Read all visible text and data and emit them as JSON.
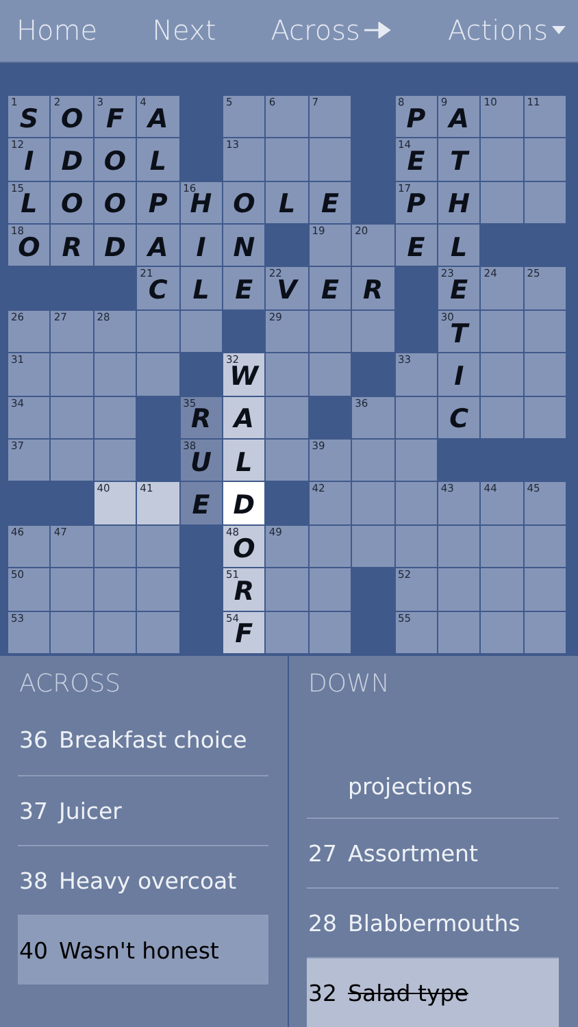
{
  "toolbar": {
    "items": [
      {
        "label": "Home",
        "kind": "plain"
      },
      {
        "label": "Next",
        "kind": "plain"
      },
      {
        "label": "Across",
        "kind": "arrow"
      },
      {
        "label": "Actions",
        "kind": "menu"
      }
    ]
  },
  "grid": {
    "rows": [
      [
        {
          "kind": "cell",
          "number": "1",
          "letter": "S"
        },
        {
          "kind": "cell",
          "number": "2",
          "letter": "O"
        },
        {
          "kind": "cell",
          "number": "3",
          "letter": "F"
        },
        {
          "kind": "cell",
          "number": "4",
          "letter": "A"
        },
        {
          "kind": "block"
        },
        {
          "kind": "cell",
          "number": "5"
        },
        {
          "kind": "cell",
          "number": "6"
        },
        {
          "kind": "cell",
          "number": "7"
        },
        {
          "kind": "block"
        },
        {
          "kind": "cell",
          "number": "8",
          "letter": "P"
        },
        {
          "kind": "cell",
          "number": "9",
          "letter": "A"
        },
        {
          "kind": "cell",
          "number": "10"
        },
        {
          "kind": "cell",
          "number": "11"
        }
      ],
      [
        {
          "kind": "cell",
          "number": "12",
          "letter": "I"
        },
        {
          "kind": "cell",
          "letter": "D"
        },
        {
          "kind": "cell",
          "letter": "O"
        },
        {
          "kind": "cell",
          "letter": "L"
        },
        {
          "kind": "block"
        },
        {
          "kind": "cell",
          "number": "13"
        },
        {
          "kind": "cell"
        },
        {
          "kind": "cell"
        },
        {
          "kind": "block"
        },
        {
          "kind": "cell",
          "number": "14",
          "letter": "E"
        },
        {
          "kind": "cell",
          "letter": "T"
        },
        {
          "kind": "cell"
        },
        {
          "kind": "cell"
        }
      ],
      [
        {
          "kind": "cell",
          "number": "15",
          "letter": "L"
        },
        {
          "kind": "cell",
          "letter": "O"
        },
        {
          "kind": "cell",
          "letter": "O"
        },
        {
          "kind": "cell",
          "letter": "P"
        },
        {
          "kind": "cell",
          "number": "16",
          "letter": "H"
        },
        {
          "kind": "cell",
          "letter": "O"
        },
        {
          "kind": "cell",
          "letter": "L"
        },
        {
          "kind": "cell",
          "letter": "E"
        },
        {
          "kind": "block"
        },
        {
          "kind": "cell",
          "number": "17",
          "letter": "P"
        },
        {
          "kind": "cell",
          "letter": "H"
        },
        {
          "kind": "cell"
        },
        {
          "kind": "cell"
        }
      ],
      [
        {
          "kind": "cell",
          "number": "18",
          "letter": "O"
        },
        {
          "kind": "cell",
          "letter": "R"
        },
        {
          "kind": "cell",
          "letter": "D"
        },
        {
          "kind": "cell",
          "letter": "A"
        },
        {
          "kind": "cell",
          "letter": "I"
        },
        {
          "kind": "cell",
          "letter": "N"
        },
        {
          "kind": "block"
        },
        {
          "kind": "cell",
          "number": "19"
        },
        {
          "kind": "cell",
          "number": "20"
        },
        {
          "kind": "cell",
          "letter": "E"
        },
        {
          "kind": "cell",
          "letter": "L"
        },
        {
          "kind": "block"
        },
        {
          "kind": "block"
        }
      ],
      [
        {
          "kind": "block"
        },
        {
          "kind": "block"
        },
        {
          "kind": "block"
        },
        {
          "kind": "cell",
          "number": "21",
          "letter": "C"
        },
        {
          "kind": "cell",
          "letter": "L"
        },
        {
          "kind": "cell",
          "letter": "E"
        },
        {
          "kind": "cell",
          "number": "22",
          "letter": "V"
        },
        {
          "kind": "cell",
          "letter": "E"
        },
        {
          "kind": "cell",
          "letter": "R"
        },
        {
          "kind": "block"
        },
        {
          "kind": "cell",
          "number": "23",
          "letter": "E"
        },
        {
          "kind": "cell",
          "number": "24"
        },
        {
          "kind": "cell",
          "number": "25"
        }
      ],
      [
        {
          "kind": "cell",
          "number": "26"
        },
        {
          "kind": "cell",
          "number": "27"
        },
        {
          "kind": "cell",
          "number": "28"
        },
        {
          "kind": "cell"
        },
        {
          "kind": "cell"
        },
        {
          "kind": "block"
        },
        {
          "kind": "cell",
          "number": "29"
        },
        {
          "kind": "cell"
        },
        {
          "kind": "cell"
        },
        {
          "kind": "block"
        },
        {
          "kind": "cell",
          "number": "30",
          "letter": "T"
        },
        {
          "kind": "cell"
        },
        {
          "kind": "cell"
        }
      ],
      [
        {
          "kind": "cell",
          "number": "31"
        },
        {
          "kind": "cell"
        },
        {
          "kind": "cell"
        },
        {
          "kind": "cell"
        },
        {
          "kind": "block"
        },
        {
          "kind": "word-cell",
          "number": "32",
          "letter": "W"
        },
        {
          "kind": "cell"
        },
        {
          "kind": "cell"
        },
        {
          "kind": "block"
        },
        {
          "kind": "cell",
          "number": "33"
        },
        {
          "kind": "cell",
          "letter": "I"
        },
        {
          "kind": "cell"
        },
        {
          "kind": "cell"
        }
      ],
      [
        {
          "kind": "cell",
          "number": "34"
        },
        {
          "kind": "cell"
        },
        {
          "kind": "cell"
        },
        {
          "kind": "block"
        },
        {
          "kind": "shaded-cell",
          "number": "35",
          "letter": "R"
        },
        {
          "kind": "word-cell",
          "letter": "A"
        },
        {
          "kind": "cell"
        },
        {
          "kind": "block"
        },
        {
          "kind": "cell",
          "number": "36"
        },
        {
          "kind": "cell"
        },
        {
          "kind": "cell",
          "letter": "C"
        },
        {
          "kind": "cell"
        },
        {
          "kind": "cell"
        }
      ],
      [
        {
          "kind": "cell",
          "number": "37"
        },
        {
          "kind": "cell"
        },
        {
          "kind": "cell"
        },
        {
          "kind": "block"
        },
        {
          "kind": "shaded-cell",
          "number": "38",
          "letter": "U"
        },
        {
          "kind": "word-cell",
          "letter": "L"
        },
        {
          "kind": "cell"
        },
        {
          "kind": "cell",
          "number": "39"
        },
        {
          "kind": "cell"
        },
        {
          "kind": "cell"
        },
        {
          "kind": "block"
        },
        {
          "kind": "block"
        },
        {
          "kind": "block"
        }
      ],
      [
        {
          "kind": "block"
        },
        {
          "kind": "block"
        },
        {
          "kind": "word-cell",
          "number": "40"
        },
        {
          "kind": "word-cell",
          "number": "41"
        },
        {
          "kind": "shaded-cell",
          "letter": "E"
        },
        {
          "kind": "cursor-cell",
          "letter": "D"
        },
        {
          "kind": "block"
        },
        {
          "kind": "cell",
          "number": "42"
        },
        {
          "kind": "cell"
        },
        {
          "kind": "cell"
        },
        {
          "kind": "cell",
          "number": "43"
        },
        {
          "kind": "cell",
          "number": "44"
        },
        {
          "kind": "cell",
          "number": "45"
        }
      ],
      [
        {
          "kind": "cell",
          "number": "46"
        },
        {
          "kind": "cell",
          "number": "47"
        },
        {
          "kind": "cell"
        },
        {
          "kind": "cell"
        },
        {
          "kind": "block"
        },
        {
          "kind": "word-cell",
          "number": "48",
          "letter": "O"
        },
        {
          "kind": "cell",
          "number": "49"
        },
        {
          "kind": "cell"
        },
        {
          "kind": "cell"
        },
        {
          "kind": "cell"
        },
        {
          "kind": "cell"
        },
        {
          "kind": "cell"
        },
        {
          "kind": "cell"
        }
      ],
      [
        {
          "kind": "cell",
          "number": "50"
        },
        {
          "kind": "cell"
        },
        {
          "kind": "cell"
        },
        {
          "kind": "cell"
        },
        {
          "kind": "block"
        },
        {
          "kind": "word-cell",
          "number": "51",
          "letter": "R"
        },
        {
          "kind": "cell"
        },
        {
          "kind": "cell"
        },
        {
          "kind": "block"
        },
        {
          "kind": "cell",
          "number": "52"
        },
        {
          "kind": "cell"
        },
        {
          "kind": "cell"
        },
        {
          "kind": "cell"
        }
      ],
      [
        {
          "kind": "cell",
          "number": "53"
        },
        {
          "kind": "cell"
        },
        {
          "kind": "cell"
        },
        {
          "kind": "cell"
        },
        {
          "kind": "block"
        },
        {
          "kind": "word-cell",
          "number": "54",
          "letter": "F"
        },
        {
          "kind": "cell"
        },
        {
          "kind": "cell"
        },
        {
          "kind": "block"
        },
        {
          "kind": "cell",
          "number": "55"
        },
        {
          "kind": "cell"
        },
        {
          "kind": "cell"
        },
        {
          "kind": "cell"
        }
      ]
    ]
  },
  "clue_panels": [
    {
      "heading": "ACROSS",
      "clues": [
        {
          "number": "36",
          "text": "Breakfast choice",
          "selected": false,
          "done": false
        },
        {
          "number": "37",
          "text": "Juicer",
          "selected": false,
          "done": false
        },
        {
          "number": "38",
          "text": "Heavy overcoat",
          "selected": false,
          "done": false
        },
        {
          "number": "40",
          "text": "Wasn't honest",
          "selected": true,
          "done": false
        }
      ]
    },
    {
      "heading": "DOWN",
      "clues": [
        {
          "text": "projections",
          "selected": false,
          "done": false
        },
        {
          "number": "27",
          "text": "Assortment",
          "selected": false,
          "done": false
        },
        {
          "number": "28",
          "text": "Blabbermouths",
          "selected": false,
          "done": false
        },
        {
          "number": "32",
          "text": "Salad type",
          "selected": true,
          "done": true
        }
      ]
    }
  ]
}
